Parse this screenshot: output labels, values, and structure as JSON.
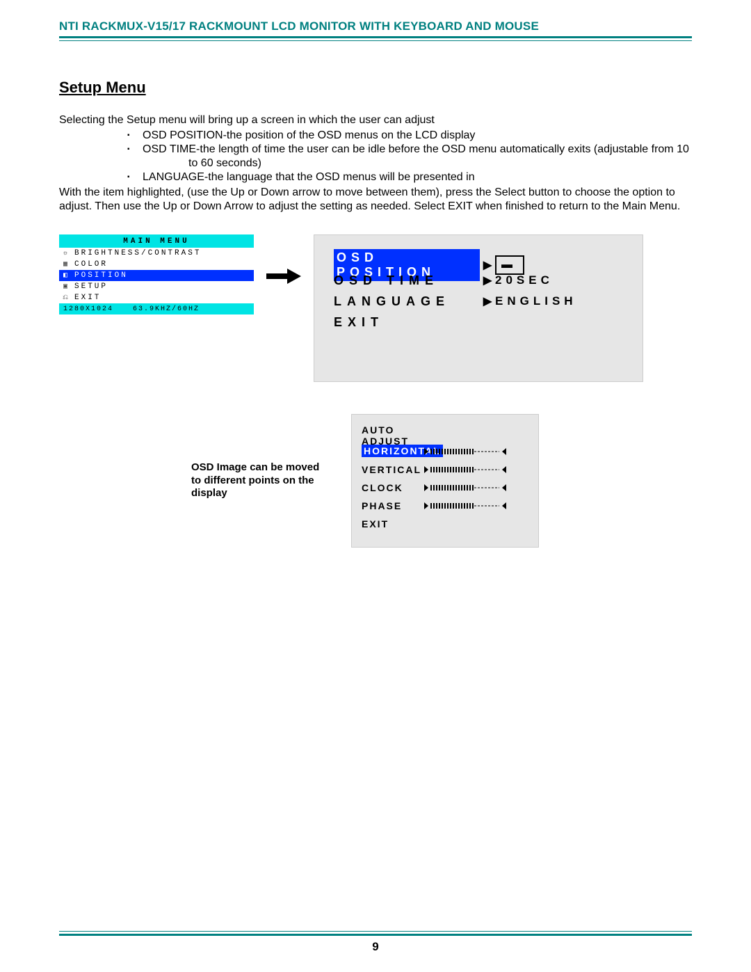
{
  "header": {
    "title": "NTI RACKMUX-V15/17  RACKMOUNT LCD MONITOR WITH KEYBOARD AND MOUSE"
  },
  "section": {
    "heading": "Setup Menu"
  },
  "text": {
    "lead": "Selecting the Setup menu will bring up a screen in which the user can adjust",
    "bullets": [
      "OSD POSITION-the position of the OSD menus on the LCD display",
      "OSD TIME-the length of time the user can be idle before the OSD menu automatically exits (adjustable from 10",
      "LANGUAGE-the language that the OSD menus will be presented in"
    ],
    "b2_cont": "to 60 seconds)",
    "para": "With the item highlighted,   (use the Up or Down arrow to move between them),   press the Select button to choose the option to adjust.     Then use the Up or Down Arrow to adjust the setting as needed.    Select EXIT when finished to return to the Main Menu.",
    "caption": "OSD Image can be moved to different points on the display"
  },
  "main_menu": {
    "title": "MAIN  MENU",
    "items": [
      {
        "icon": "☼",
        "label": "BRIGHTNESS/CONTRAST",
        "selected": false
      },
      {
        "icon": "▦",
        "label": "COLOR",
        "selected": false
      },
      {
        "icon": "◧",
        "label": "POSITION",
        "selected": true
      },
      {
        "icon": "▣",
        "label": "SETUP",
        "selected": false
      },
      {
        "icon": "⎌",
        "label": "EXIT",
        "selected": false
      }
    ],
    "status_left": "1280X1024",
    "status_right": "63.9KHZ/60HZ"
  },
  "osd_setup": {
    "rows": [
      {
        "label": "OSD POSITION",
        "selected": true,
        "value_icon": "▬"
      },
      {
        "label": "OSD TIME",
        "selected": false,
        "value": "20SEC"
      },
      {
        "label": "LANGUAGE",
        "selected": false,
        "value": "ENGLISH"
      },
      {
        "label": "EXIT",
        "selected": false,
        "value": ""
      }
    ]
  },
  "position_panel": {
    "rows": [
      {
        "label": "AUTO ADJUST",
        "slider": false,
        "selected": false
      },
      {
        "label": "HORIZONTAL",
        "slider": true,
        "selected": true
      },
      {
        "label": "VERTICAL",
        "slider": true,
        "selected": false
      },
      {
        "label": "CLOCK",
        "slider": true,
        "selected": false
      },
      {
        "label": "PHASE",
        "slider": true,
        "selected": false
      },
      {
        "label": "EXIT",
        "slider": false,
        "selected": false
      }
    ]
  },
  "footer": {
    "page": "9"
  }
}
